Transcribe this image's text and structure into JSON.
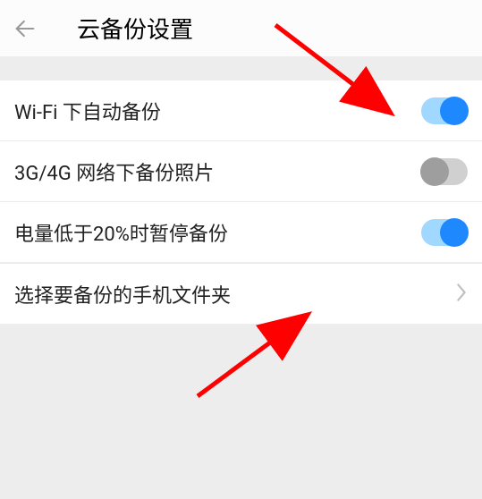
{
  "header": {
    "title": "云备份设置"
  },
  "settings": [
    {
      "label": "Wi-Fi 下自动备份",
      "state": "on"
    },
    {
      "label": "3G/4G 网络下备份照片",
      "state": "off"
    },
    {
      "label": "电量低于20%时暂停备份",
      "state": "on"
    }
  ],
  "nav_item": {
    "label": "选择要备份的手机文件夹"
  }
}
